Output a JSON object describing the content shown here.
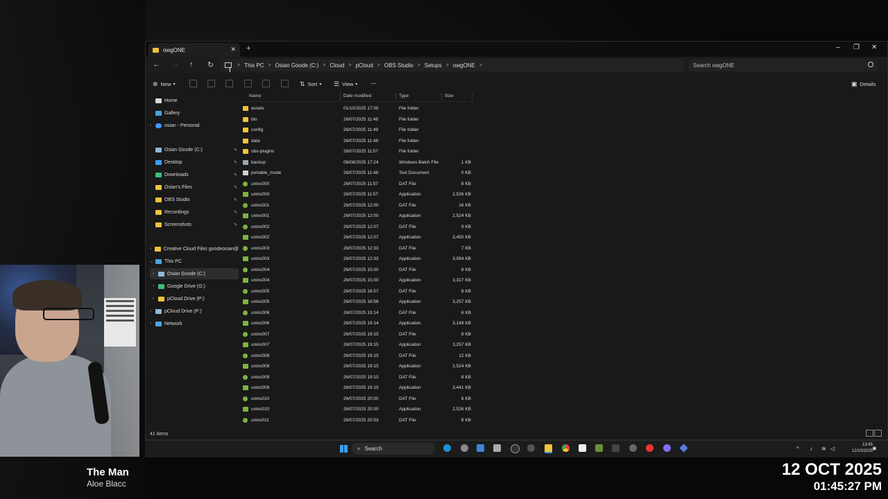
{
  "window": {
    "tab_title": "owgONE",
    "breadcrumbs": [
      "This PC",
      "Osian Goode (C:)",
      "Cloud",
      "pCloud",
      "OBS Studio",
      "Setups",
      "owgONE"
    ],
    "search_placeholder": "Search owgONE",
    "commands": {
      "new": "New",
      "sort": "Sort",
      "view": "View",
      "more": "···",
      "details": "Details"
    }
  },
  "nav": {
    "home": "Home",
    "gallery": "Gallery",
    "personal": "osian - Personal",
    "quick": [
      "Osian Goode (C:)",
      "Desktop",
      "Downloads",
      "Osian's Files",
      "OBS Studio",
      "Recordings",
      "Screenshots"
    ],
    "creative": "Creative Cloud Files  goodeosian@",
    "this_pc": "This PC",
    "drives": [
      "Osian Goode (C:)",
      "Google Drive (G:)",
      "pCloud Drive (P:)"
    ],
    "pcloud_drive": "pCloud Drive (P:)",
    "network": "Network"
  },
  "columns": {
    "name": "Name",
    "date": "Date modified",
    "type": "Type",
    "size": "Size"
  },
  "files": [
    {
      "name": "assets",
      "date": "01/10/2025 17:05",
      "type": "File folder",
      "size": "",
      "kind": "folder"
    },
    {
      "name": "bin",
      "date": "26/07/2025 11:48",
      "type": "File folder",
      "size": "",
      "kind": "folder"
    },
    {
      "name": "config",
      "date": "26/07/2025 11:49",
      "type": "File folder",
      "size": "",
      "kind": "folder"
    },
    {
      "name": "data",
      "date": "26/07/2025 11:48",
      "type": "File folder",
      "size": "",
      "kind": "folder"
    },
    {
      "name": "obs-plugins",
      "date": "26/07/2025 11:57",
      "type": "File folder",
      "size": "",
      "kind": "folder"
    },
    {
      "name": "backup",
      "date": "06/08/2025 17:24",
      "type": "Windows Batch File",
      "size": "1 KB",
      "kind": "bat"
    },
    {
      "name": "portable_mode",
      "date": "26/07/2025 11:48",
      "type": "Text Document",
      "size": "0 KB",
      "kind": "txt"
    },
    {
      "name": "unins000",
      "date": "26/07/2025 11:57",
      "type": "DAT File",
      "size": "8 KB",
      "kind": "dat"
    },
    {
      "name": "unins000",
      "date": "26/07/2025 11:57",
      "type": "Application",
      "size": "2,526 KB",
      "kind": "app"
    },
    {
      "name": "unins001",
      "date": "26/07/2025 12:00",
      "type": "DAT File",
      "size": "16 KB",
      "kind": "dat"
    },
    {
      "name": "unins001",
      "date": "26/07/2025 12:00",
      "type": "Application",
      "size": "2,524 KB",
      "kind": "app"
    },
    {
      "name": "unins002",
      "date": "26/07/2025 12:07",
      "type": "DAT File",
      "size": "9 KB",
      "kind": "dat"
    },
    {
      "name": "unins002",
      "date": "26/07/2025 12:07",
      "type": "Application",
      "size": "3,450 KB",
      "kind": "app"
    },
    {
      "name": "unins003",
      "date": "26/07/2025 12:33",
      "type": "DAT File",
      "size": "7 KB",
      "kind": "dat"
    },
    {
      "name": "unins003",
      "date": "26/07/2025 12:33",
      "type": "Application",
      "size": "3,084 KB",
      "kind": "app"
    },
    {
      "name": "unins004",
      "date": "26/07/2025 15:00",
      "type": "DAT File",
      "size": "8 KB",
      "kind": "dat"
    },
    {
      "name": "unins004",
      "date": "26/07/2025 15:00",
      "type": "Application",
      "size": "3,327 KB",
      "kind": "app"
    },
    {
      "name": "unins005",
      "date": "26/07/2025 18:57",
      "type": "DAT File",
      "size": "8 KB",
      "kind": "dat"
    },
    {
      "name": "unins005",
      "date": "26/07/2025 18:56",
      "type": "Application",
      "size": "3,257 KB",
      "kind": "app"
    },
    {
      "name": "unins006",
      "date": "26/07/2025 19:14",
      "type": "DAT File",
      "size": "6 KB",
      "kind": "dat"
    },
    {
      "name": "unins006",
      "date": "26/07/2025 19:14",
      "type": "Application",
      "size": "3,149 KB",
      "kind": "app"
    },
    {
      "name": "unins007",
      "date": "26/07/2025 19:15",
      "type": "DAT File",
      "size": "8 KB",
      "kind": "dat"
    },
    {
      "name": "unins007",
      "date": "26/07/2025 19:15",
      "type": "Application",
      "size": "3,257 KB",
      "kind": "app"
    },
    {
      "name": "unins008",
      "date": "26/07/2025 19:15",
      "type": "DAT File",
      "size": "12 KB",
      "kind": "dat"
    },
    {
      "name": "unins008",
      "date": "26/07/2025 19:15",
      "type": "Application",
      "size": "2,524 KB",
      "kind": "app"
    },
    {
      "name": "unins009",
      "date": "26/07/2025 19:15",
      "type": "DAT File",
      "size": "8 KB",
      "kind": "dat"
    },
    {
      "name": "unins009",
      "date": "26/07/2025 19:15",
      "type": "Application",
      "size": "3,441 KB",
      "kind": "app"
    },
    {
      "name": "unins010",
      "date": "26/07/2025 20:00",
      "type": "DAT File",
      "size": "8 KB",
      "kind": "dat"
    },
    {
      "name": "unins010",
      "date": "26/07/2025 20:00",
      "type": "Application",
      "size": "2,526 KB",
      "kind": "app"
    },
    {
      "name": "unins011",
      "date": "26/07/2025 20:03",
      "type": "DAT File",
      "size": "8 KB",
      "kind": "dat"
    }
  ],
  "status": {
    "items": "41 items"
  },
  "taskbar": {
    "search": "Search",
    "time": "13:45",
    "date": "12/10/2025"
  },
  "overlay": {
    "song_title": "The Man",
    "song_artist": "Aloe Blacc",
    "date": "12 OCT 2025",
    "time": "01:45:27 PM"
  },
  "colors": {
    "folder": "#f0c33a",
    "accent": "#3b9cff",
    "window_bg": "#191919"
  }
}
